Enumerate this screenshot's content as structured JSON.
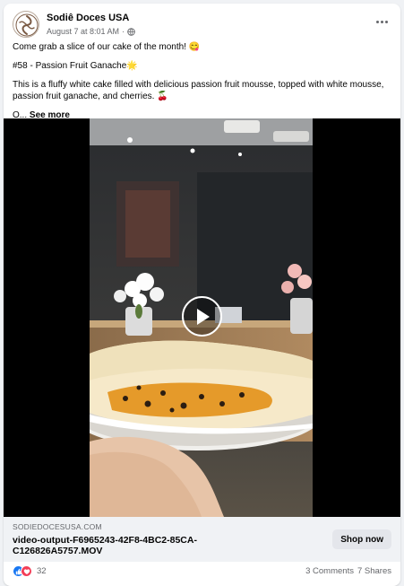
{
  "post": {
    "author": "Sodiê Doces USA",
    "date": "August 7 at 8:01 AM",
    "date_separator": "·",
    "text": {
      "line1": "Come grab a slice of our cake of the month! 😋",
      "line2": "#58 - Passion Fruit Ganache🌟",
      "line3": "This is a fluffy white cake filled with delicious passion fruit mousse, topped with white mousse, passion fruit ganache, and cherries. 🍒",
      "line4_prefix": "O...",
      "see_more": "See more"
    }
  },
  "icons": {
    "avatar": "sodie-logo-icon",
    "privacy": "globe-icon",
    "options": "more-options-icon",
    "play": "play-icon",
    "reaction1": "like-icon",
    "reaction2": "love-icon"
  },
  "link": {
    "domain": "SODIEDOCESUSA.COM",
    "title": "video-output-F6965243-42F8-4BC2-85CA-C126826A5757.MOV",
    "cta": "Shop now"
  },
  "footer": {
    "reaction_count": "32",
    "comments": "3 Comments",
    "shares": "7 Shares"
  },
  "colors": {
    "brand_blue": "#1877f2",
    "love_red": "#f33e58",
    "secondary_text": "#65676b",
    "preview_bg": "#f0f2f5",
    "button_bg": "#e4e6eb"
  }
}
